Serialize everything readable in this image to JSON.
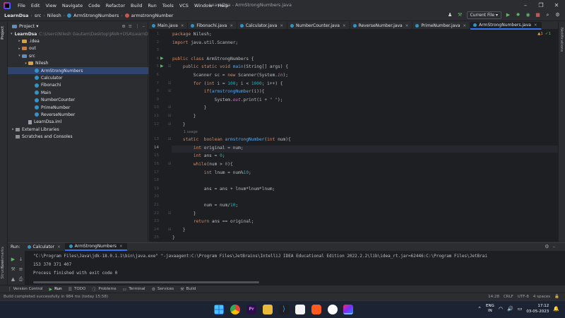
{
  "window": {
    "title": "LearnDsa - ArmStrongNumbers.java",
    "menu": [
      "File",
      "Edit",
      "View",
      "Navigate",
      "Code",
      "Refactor",
      "Build",
      "Run",
      "Tools",
      "VCS",
      "Window",
      "Help"
    ],
    "controls": [
      "–",
      "❐",
      "✕"
    ]
  },
  "breadcrumb": [
    "LearnDsa",
    "src",
    "Nilesh",
    "ArmStrongNumbers",
    "armstrongNumber"
  ],
  "toolbar": {
    "run_config": "Current File ▾"
  },
  "left_strip": {
    "project": "Project",
    "bookmarks": "Bookmarks",
    "structure": "Structure"
  },
  "right_strip": {
    "notifications": "Notifications"
  },
  "project_panel": {
    "title": "Project ▾",
    "tree": [
      {
        "label": "LearnDsa",
        "detail": "C:\\Users\\Nilesh Gautam\\Desktop\\JAVA+DSA\\LearnDsa",
        "depth": 0,
        "arrow": "▾",
        "icon": "folder-blue"
      },
      {
        "label": ".idea",
        "detail": "",
        "depth": 1,
        "arrow": "▸",
        "icon": "folder"
      },
      {
        "label": "out",
        "detail": "",
        "depth": 1,
        "arrow": "▸",
        "icon": "folder-orange"
      },
      {
        "label": "src",
        "detail": "",
        "depth": 1,
        "arrow": "▾",
        "icon": "folder-blue"
      },
      {
        "label": "Nilesh",
        "detail": "",
        "depth": 2,
        "arrow": "▾",
        "icon": "folder"
      },
      {
        "label": "ArmStrongNumbers",
        "detail": "",
        "depth": 3,
        "arrow": "",
        "icon": "class",
        "selected": true
      },
      {
        "label": "Calculator",
        "detail": "",
        "depth": 3,
        "arrow": "",
        "icon": "class"
      },
      {
        "label": "Fibonachi",
        "detail": "",
        "depth": 3,
        "arrow": "",
        "icon": "class"
      },
      {
        "label": "Main",
        "detail": "",
        "depth": 3,
        "arrow": "",
        "icon": "class"
      },
      {
        "label": "NumberCounter",
        "detail": "",
        "depth": 3,
        "arrow": "",
        "icon": "class"
      },
      {
        "label": "PrimeNumber",
        "detail": "",
        "depth": 3,
        "arrow": "",
        "icon": "class"
      },
      {
        "label": "ReverseNumber",
        "detail": "",
        "depth": 3,
        "arrow": "",
        "icon": "class"
      },
      {
        "label": "LearnDsa.iml",
        "detail": "",
        "depth": 2,
        "arrow": "",
        "icon": "file"
      },
      {
        "label": "External Libraries",
        "detail": "",
        "depth": 0,
        "arrow": "▸",
        "icon": "lib"
      },
      {
        "label": "Scratches and Consoles",
        "detail": "",
        "depth": 0,
        "arrow": "",
        "icon": "lib"
      }
    ]
  },
  "editor_tabs": [
    {
      "label": "Main.java",
      "active": false
    },
    {
      "label": "Fibonachi.java",
      "active": false
    },
    {
      "label": "Calculator.java",
      "active": false
    },
    {
      "label": "NumberCounter.java",
      "active": false
    },
    {
      "label": "ReverseNumber.java",
      "active": false
    },
    {
      "label": "PrimeNumber.java",
      "active": false
    },
    {
      "label": "ArmStrongNumbers.java",
      "active": true
    }
  ],
  "editor": {
    "indicators": {
      "warnings": "▲1",
      "ok": "✓1"
    },
    "usage_hint": "1 usage",
    "current_line": 14,
    "lines": [
      "package Nilesh;",
      "import java.util.Scanner;",
      "",
      "public class ArmStrongNumbers {",
      "    public static void main(String[] args) {",
      "        Scanner sc = new Scanner(System.in);",
      "        for (int i = 100; i < 1000; i++) {",
      "            if(armstrongNumber(i)){",
      "                System.out.print(i + \" \");",
      "            }",
      "        }",
      "    }",
      "    static  boolean armstrongNumber(int num){",
      "        int original = num;",
      "        int ans = 0;",
      "        while(num > 0){",
      "            int lnum = num%10;",
      "",
      "            ans = ans + lnum*lnum*lnum;",
      "",
      "            num = num/10;",
      "        }",
      "        return ans == original;",
      "    }",
      "}"
    ]
  },
  "run_panel": {
    "label": "Run:",
    "tabs": [
      {
        "label": "Calculator",
        "active": false
      },
      {
        "label": "ArmStrongNumbers",
        "active": true
      }
    ],
    "console": [
      "\"C:\\Program Files\\Java\\jdk-18.0.1.1\\bin\\java.exe\" \"-javaagent:C:\\Program Files\\JetBrains\\IntelliJ IDEA Educational Edition 2022.2.2\\lib\\idea_rt.jar=62446:C:\\Program Files\\JetBrai",
      "153 370 371 407",
      "Process finished with exit code 0"
    ]
  },
  "bottom_tools": [
    "Version Control",
    "Run",
    "TODO",
    "Problems",
    "Terminal",
    "Services",
    "Build"
  ],
  "status": {
    "message": "Build completed successfully in 984 ms (today 15:58)",
    "position": "14:28",
    "line_sep": "CRLF",
    "encoding": "UTF-8",
    "indent": "4 spaces"
  },
  "taskbar": {
    "lang_top": "ENG",
    "lang_bottom": "IN",
    "time": "17:12",
    "date": "03-05-2023"
  },
  "colors": {
    "accent": "#3574f0",
    "keyword": "#cf8e6d",
    "function": "#56a8f5",
    "number": "#2aacb8",
    "string": "#6aab73"
  }
}
